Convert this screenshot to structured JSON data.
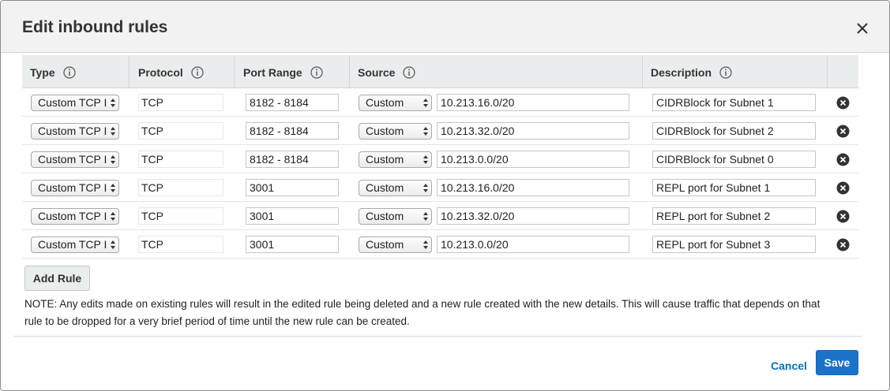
{
  "dialog": {
    "title": "Edit inbound rules"
  },
  "columns": {
    "type": "Type",
    "protocol": "Protocol",
    "port_range": "Port Range",
    "source": "Source",
    "description": "Description"
  },
  "rules": [
    {
      "type": "Custom TCP I",
      "protocol": "TCP",
      "port_range": "8182 - 8184",
      "source_type": "Custom",
      "source": "10.213.16.0/20",
      "description": "CIDRBlock for Subnet 1"
    },
    {
      "type": "Custom TCP I",
      "protocol": "TCP",
      "port_range": "8182 - 8184",
      "source_type": "Custom",
      "source": "10.213.32.0/20",
      "description": "CIDRBlock for Subnet 2"
    },
    {
      "type": "Custom TCP I",
      "protocol": "TCP",
      "port_range": "8182 - 8184",
      "source_type": "Custom",
      "source": "10.213.0.0/20",
      "description": "CIDRBlock for Subnet 0"
    },
    {
      "type": "Custom TCP I",
      "protocol": "TCP",
      "port_range": "3001",
      "source_type": "Custom",
      "source": "10.213.16.0/20",
      "description": "REPL port for Subnet 1"
    },
    {
      "type": "Custom TCP I",
      "protocol": "TCP",
      "port_range": "3001",
      "source_type": "Custom",
      "source": "10.213.32.0/20",
      "description": "REPL port for Subnet 2"
    },
    {
      "type": "Custom TCP I",
      "protocol": "TCP",
      "port_range": "3001",
      "source_type": "Custom",
      "source": "10.213.0.0/20",
      "description": "REPL port for Subnet 3"
    }
  ],
  "add_rule_label": "Add Rule",
  "note": "NOTE: Any edits made on existing rules will result in the edited rule being deleted and a new rule created with the new details. This will cause traffic that depends on that rule to be dropped for a very brief period of time until the new rule can be created.",
  "footer": {
    "cancel_label": "Cancel",
    "save_label": "Save"
  },
  "colors": {
    "accent": "#1a73c8",
    "link": "#0073bb",
    "header_bg": "#f2f2f2",
    "table_head_bg": "#eaeded"
  },
  "icons": {
    "close": "close-icon",
    "info": "info-icon",
    "remove": "remove-circle-icon",
    "select_arrows": "select-arrows-icon"
  }
}
